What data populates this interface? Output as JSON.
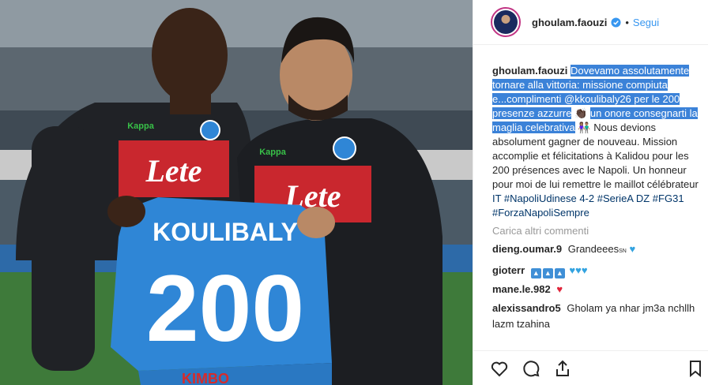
{
  "post": {
    "username": "ghoulam.faouzi",
    "follow_label": "Segui",
    "dot": "•",
    "caption_user": "ghoulam.faouzi",
    "caption_highlight_1": "Dovevamo assolutamente tornare alla vittoria: missione compiuta e...complimenti @kkoulibaly26 per le 200 presenze azzurre",
    "caption_emoji_1": "👏🏿",
    "caption_highlight_2": "un onore consegnarti la maglia celebrativa",
    "caption_emoji_2": "👫🏽",
    "caption_rest": "Nous devions absolument gagner de nouveau. Mission accomplie et félicitations à Kalidou pour les 200 présences avec le Napoli. Un honneur pour moi de lui remettre le maillot célébrateur",
    "caption_tags": "IT #NapoliUdinese 4-2 #SerieA DZ #FG31 #ForzaNapoliSempre",
    "load_more": "Carica altri commenti"
  },
  "photo": {
    "sponsor": "Lete",
    "brand": "Kappa",
    "jersey_name": "KOULIBALY",
    "jersey_number": "200",
    "shirt_sponsor_bottom": "KIMBO"
  },
  "comments": [
    {
      "user": "dieng.oumar.9",
      "text": "Grandeees",
      "suffix": "SN"
    },
    {
      "user": "gioterr",
      "text": ""
    },
    {
      "user": "mane.le.982",
      "text": ""
    },
    {
      "user": "alexissandro5",
      "text": "Gholam ya nhar jm3a nchllh lazm tzahina"
    }
  ],
  "icons": [
    "like-icon",
    "comment-icon",
    "share-icon",
    "save-icon",
    "verified-icon"
  ],
  "colors": {
    "accent": "#3897f0",
    "highlight": "#3b82d8",
    "napoli_blue": "#2f86d6"
  }
}
